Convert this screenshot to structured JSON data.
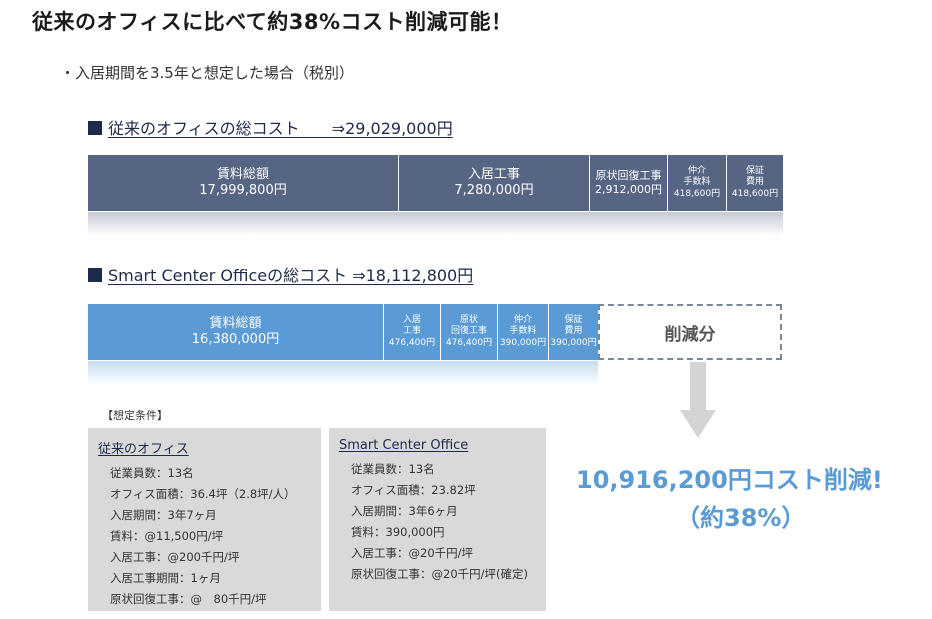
{
  "title": "従来のオフィスに比べて約38%コスト削減可能！",
  "subtitle": "・入居期間を3.5年と想定した場合（税別）",
  "traditional": {
    "heading": "従来のオフィスの総コスト　　⇒29,029,000円",
    "segments": [
      {
        "label": "賃料総額",
        "value": "17,999,800円"
      },
      {
        "label": "入居工事",
        "value": "7,280,000円"
      },
      {
        "label": "原状回復工事",
        "value": "2,912,000円"
      },
      {
        "label": "仲介\n手数料",
        "value": "418,600円"
      },
      {
        "label": "保証\n費用",
        "value": "418,600円"
      }
    ]
  },
  "smart": {
    "heading": "Smart Center Officeの総コスト ⇒18,112,800円",
    "segments": [
      {
        "label": "賃料総額",
        "value": "16,380,000円"
      },
      {
        "label": "入居\n工事",
        "value": "476,400円"
      },
      {
        "label": "原状\n回復工事",
        "value": "476,400円"
      },
      {
        "label": "仲介\n手数料",
        "value": "390,000円"
      },
      {
        "label": "保証\n費用",
        "value": "390,000円"
      }
    ],
    "savings_label": "削減分"
  },
  "conditions": {
    "label": "【想定条件】",
    "traditional": {
      "heading": "従来のオフィス",
      "rows": [
        "従業員数：13名",
        "オフィス面積：36.4坪（2.8坪/人）",
        "入居期間：3年7ヶ月",
        "賃料：@11,500円/坪",
        "入居工事：@200千円/坪",
        "入居工事期間：1ヶ月",
        "原状回復工事：@　80千円/坪"
      ]
    },
    "smart": {
      "heading": "Smart Center Office",
      "rows": [
        "従業員数：13名",
        "オフィス面積：23.82坪",
        "入居期間：3年6ヶ月",
        "賃料：390,000円",
        "入居工事：@20千円/坪",
        "原状回復工事：@20千円/坪(確定)"
      ]
    }
  },
  "result": {
    "line1": "10,916,200円コスト削減!",
    "line2": "（約38%）"
  },
  "colors": {
    "navy": "#566584",
    "blue": "#5b9bd5",
    "heading": "#1e2a4a",
    "panel": "#d9d9d9"
  }
}
